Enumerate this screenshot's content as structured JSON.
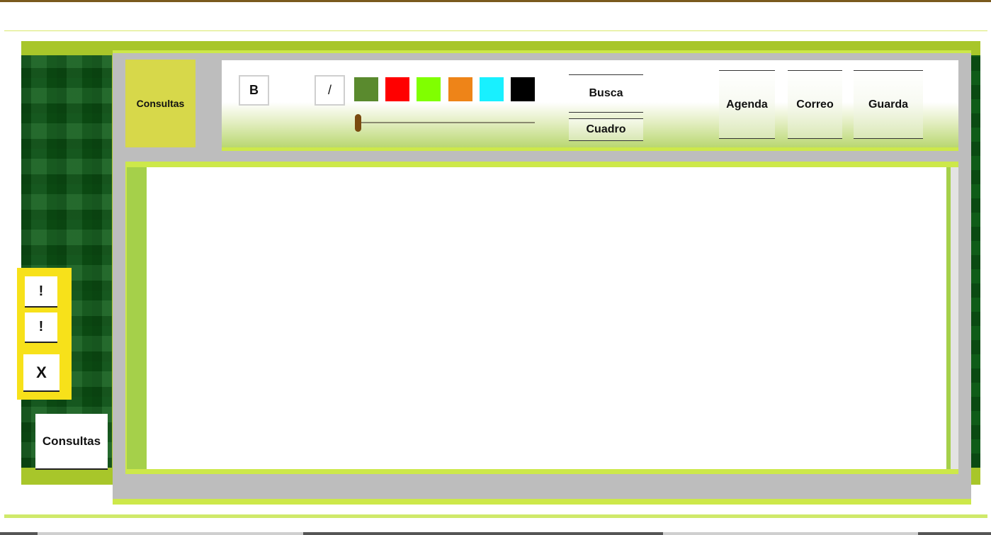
{
  "sidebar": {
    "consultas_tile_label": "Consultas",
    "alert_1_label": "!",
    "alert_2_label": "!",
    "close_label": "X",
    "consultas_button_label": "Consultas"
  },
  "toolbar": {
    "bold_label": "B",
    "italic_label": "/",
    "swatches": [
      "#5a8a2e",
      "#ff0000",
      "#80ff00",
      "#ee8418",
      "#18f0ff",
      "#000000"
    ],
    "busca_label": "Busca",
    "cuadro_label": "Cuadro",
    "agenda_label": "Agenda",
    "correo_label": "Correo",
    "guarda_label": "Guarda"
  },
  "colors": {
    "accent_lime": "#cde84a",
    "frame_green": "#a8c62a",
    "plaid_green": "#0d5a16",
    "panel_gray": "#bdbdbd",
    "side_yellow": "#f7e11a",
    "tile_yellow": "#d7d84a"
  }
}
